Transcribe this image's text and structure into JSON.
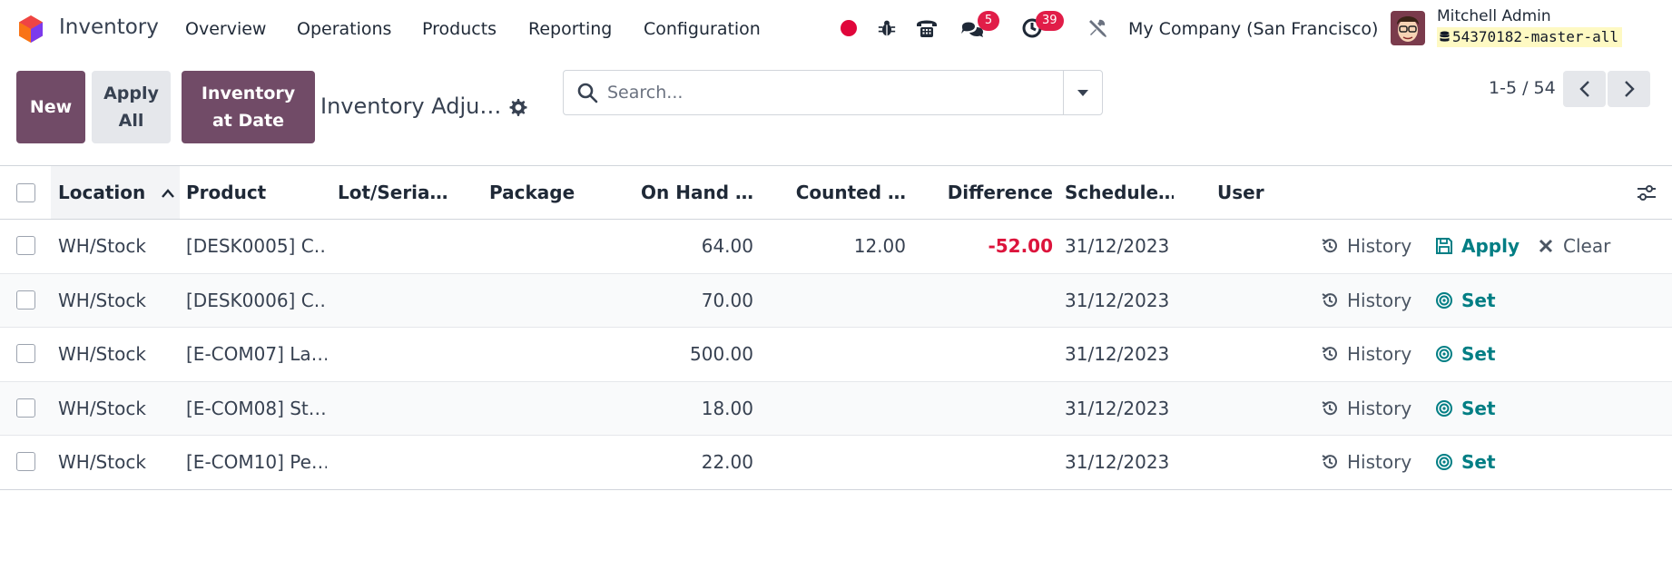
{
  "navbar": {
    "app_name": "Inventory",
    "menu": [
      "Overview",
      "Operations",
      "Products",
      "Reporting",
      "Configuration"
    ],
    "messages_count": "5",
    "activities_count": "39",
    "company": "My Company (San Francisco)",
    "user_name": "Mitchell Admin",
    "database": "54370182-master-all",
    "colors": {
      "brand": "#714b67",
      "badge": "#e11d48",
      "recording_dot": "#e0063b"
    }
  },
  "control_panel": {
    "new_label": "New",
    "apply_all_label": "Apply All",
    "inventory_at_date_label": "Inventory at Date",
    "view_title": "Inventory Adju…",
    "search_placeholder": "Search...",
    "pager_value": "1-5 / 54"
  },
  "table": {
    "columns": {
      "location": "Location",
      "product": "Product",
      "lot": "Lot/Seria…",
      "package": "Package",
      "on_hand": "On Hand …",
      "counted": "Counted …",
      "difference": "Difference",
      "scheduled": "Schedule…",
      "user": "User"
    },
    "sorted_by": "Location",
    "sort_direction": "ascending",
    "actions": {
      "history": "History",
      "apply": "Apply",
      "clear": "Clear",
      "set": "Set"
    },
    "rows": [
      {
        "location": "WH/Stock",
        "product": "[DESK0005] C…",
        "lot": "",
        "package": "",
        "on_hand": "64.00",
        "counted": "12.00",
        "difference": "-52.00",
        "scheduled": "31/12/2023",
        "user": ""
      },
      {
        "location": "WH/Stock",
        "product": "[DESK0006] C…",
        "lot": "",
        "package": "",
        "on_hand": "70.00",
        "counted": "",
        "difference": "",
        "scheduled": "31/12/2023",
        "user": ""
      },
      {
        "location": "WH/Stock",
        "product": "[E-COM07] La…",
        "lot": "",
        "package": "",
        "on_hand": "500.00",
        "counted": "",
        "difference": "",
        "scheduled": "31/12/2023",
        "user": ""
      },
      {
        "location": "WH/Stock",
        "product": "[E-COM08] St…",
        "lot": "",
        "package": "",
        "on_hand": "18.00",
        "counted": "",
        "difference": "",
        "scheduled": "31/12/2023",
        "user": ""
      },
      {
        "location": "WH/Stock",
        "product": "[E-COM10] Pe…",
        "lot": "",
        "package": "",
        "on_hand": "22.00",
        "counted": "",
        "difference": "",
        "scheduled": "31/12/2023",
        "user": ""
      }
    ]
  }
}
